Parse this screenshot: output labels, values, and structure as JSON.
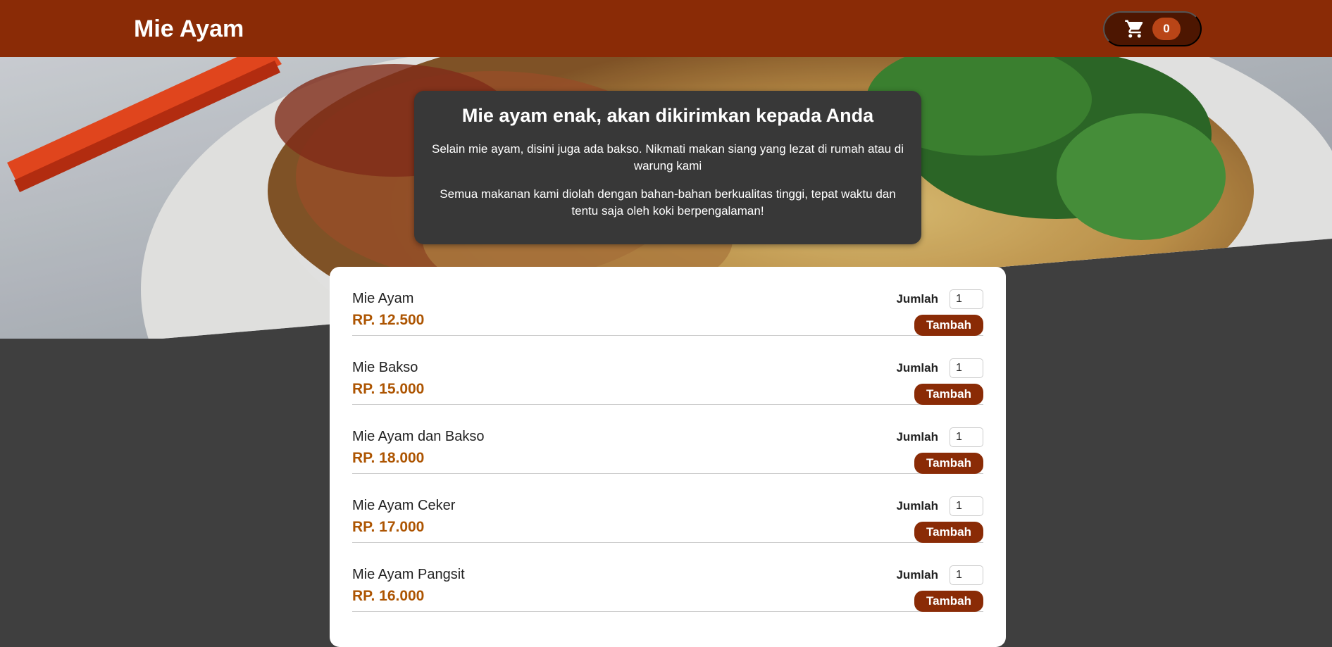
{
  "header": {
    "title": "Mie Ayam",
    "cart": {
      "icon": "cart-icon",
      "count": "0"
    }
  },
  "hero": {
    "image": "noodle-bowl-photo"
  },
  "summary": {
    "heading": "Mie ayam enak, akan dikirimkan kepada Anda",
    "paragraph1": "Selain mie ayam, disini juga ada bakso. Nikmati makan siang yang lezat di rumah atau di warung kami",
    "paragraph2": "Semua makanan kami diolah dengan bahan-bahan berkualitas tinggi, tepat waktu dan tentu saja oleh koki berpengalaman!"
  },
  "meals": [
    {
      "name": "Mie Ayam",
      "price": "RP. 12.500",
      "qty_label": "Jumlah",
      "qty": "1",
      "add_label": "Tambah"
    },
    {
      "name": "Mie Bakso",
      "price": "RP. 15.000",
      "qty_label": "Jumlah",
      "qty": "1",
      "add_label": "Tambah"
    },
    {
      "name": "Mie Ayam dan Bakso",
      "price": "RP. 18.000",
      "qty_label": "Jumlah",
      "qty": "1",
      "add_label": "Tambah"
    },
    {
      "name": "Mie Ayam Ceker",
      "price": "RP. 17.000",
      "qty_label": "Jumlah",
      "qty": "1",
      "add_label": "Tambah"
    },
    {
      "name": "Mie Ayam Pangsit",
      "price": "RP. 16.000",
      "qty_label": "Jumlah",
      "qty": "1",
      "add_label": "Tambah"
    }
  ],
  "colors": {
    "brand": "#8a2b06",
    "price": "#ad5502",
    "background": "#3f3f3f"
  }
}
